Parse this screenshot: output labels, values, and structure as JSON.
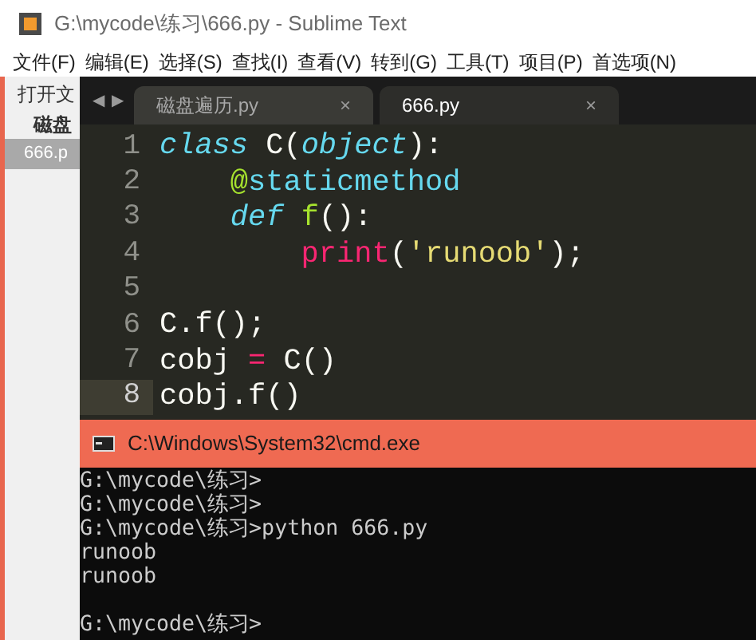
{
  "window": {
    "title": "G:\\mycode\\练习\\666.py - Sublime Text"
  },
  "menu": [
    "文件(F)",
    "编辑(E)",
    "选择(S)",
    "查找(I)",
    "查看(V)",
    "转到(G)",
    "工具(T)",
    "项目(P)",
    "首选项(N)"
  ],
  "sidebar": {
    "header": "打开文",
    "items": [
      {
        "label": "磁盘",
        "selected": false
      },
      {
        "label": "666.p",
        "selected": true
      }
    ]
  },
  "tab_nav": [
    "◀",
    "▶"
  ],
  "tabs": [
    {
      "label": "磁盘遍历.py",
      "close": "×",
      "selected": false
    },
    {
      "label": "666.py",
      "close": "×",
      "selected": true
    }
  ],
  "code": [
    {
      "number": "1",
      "current": false,
      "tokens": [
        {
          "kind": "keyword",
          "text": "class"
        },
        {
          "kind": "plain",
          "text": " C("
        },
        {
          "kind": "keyword",
          "text": "object"
        },
        {
          "kind": "plain",
          "text": "):"
        }
      ],
      "children": [
        {
          "number": "2",
          "current": false,
          "tokens": [
            {
              "kind": "function",
              "text": "@"
            },
            {
              "kind": "builtin",
              "text": "staticmethod"
            }
          ]
        },
        {
          "number": "3",
          "current": false,
          "tokens": [
            {
              "kind": "keyword",
              "text": "def "
            },
            {
              "kind": "function",
              "text": "f"
            },
            {
              "kind": "plain",
              "text": "():"
            }
          ],
          "children": [
            {
              "number": "4",
              "current": false,
              "tokens": [
                {
                  "kind": "operator",
                  "text": "print"
                },
                {
                  "kind": "plain",
                  "text": "("
                },
                {
                  "kind": "string",
                  "text": "'runoob'"
                },
                {
                  "kind": "plain",
                  "text": ");"
                }
              ]
            }
          ]
        }
      ]
    },
    {
      "number": "5",
      "current": false
    },
    {
      "number": "6",
      "current": false,
      "tokens": [
        {
          "kind": "plain",
          "text": "C.f();"
        }
      ]
    },
    {
      "number": "7",
      "current": false,
      "tokens": [
        {
          "kind": "plain",
          "text": "cobj "
        },
        {
          "kind": "operator",
          "text": "="
        },
        {
          "kind": "plain",
          "text": " C()"
        }
      ]
    },
    {
      "number": "8",
      "current": true,
      "tokens": [
        {
          "kind": "plain",
          "text": "cobj.f()"
        }
      ]
    }
  ],
  "console": {
    "title": "C:\\Windows\\System32\\cmd.exe",
    "lines": [
      {
        "text": "G:\\mycode\\练习>"
      },
      {
        "text": "G:\\mycode\\练习>"
      },
      {
        "text": "G:\\mycode\\练习>python 666.py"
      },
      {
        "text": "runoob"
      },
      {
        "text": "runoob"
      },
      {
        "text": "G:\\mycode\\练习>",
        "gap_before": true
      }
    ]
  }
}
